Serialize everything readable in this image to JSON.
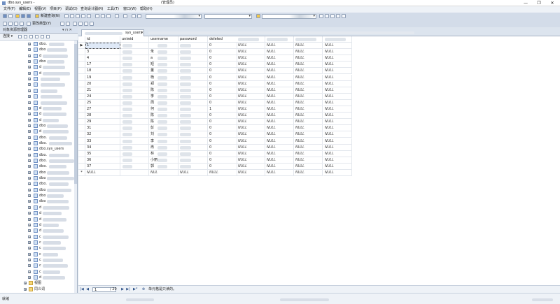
{
  "window": {
    "title": "dbo.sys_users -",
    "badge": "(管理员)",
    "minimize": "—",
    "maximize": "❐",
    "close": "✕"
  },
  "menu": [
    "文件(F)",
    "编辑(E)",
    "视图(V)",
    "项目(P)",
    "调试(D)",
    "查询设计器(R)",
    "工具(T)",
    "窗口(W)",
    "帮助(H)"
  ],
  "toolbar": {
    "new_query": "新建查询(N)",
    "change_type": "更改类型(Y)"
  },
  "object_explorer": {
    "title": "对象资源管理器",
    "pin": "▾ ⊓ ✕",
    "connect": "连接 ▾",
    "tree": [
      {
        "label": "dbo."
      },
      {
        "label": "dbo"
      },
      {
        "label": "d"
      },
      {
        "label": "dbo"
      },
      {
        "label": "d"
      },
      {
        "label": "d"
      },
      {
        "label": ""
      },
      {
        "label": ""
      },
      {
        "label": ""
      },
      {
        "label": ""
      },
      {
        "label": ""
      },
      {
        "label": "d"
      },
      {
        "label": "d"
      },
      {
        "label": "d"
      },
      {
        "label": "dbo"
      },
      {
        "label": "d"
      },
      {
        "label": "dbo."
      },
      {
        "label": "dbo."
      },
      {
        "label": "dbo.sys_users"
      },
      {
        "label": "dbo."
      },
      {
        "label": "dbo."
      },
      {
        "label": "dbo."
      },
      {
        "label": "dbo"
      },
      {
        "label": "dbo"
      },
      {
        "label": "dbo."
      },
      {
        "label": "dbo"
      },
      {
        "label": "dbo"
      },
      {
        "label": "dbo"
      },
      {
        "label": "d"
      },
      {
        "label": "d"
      },
      {
        "label": "d"
      },
      {
        "label": "d"
      },
      {
        "label": "d"
      },
      {
        "label": "c"
      },
      {
        "label": "c"
      },
      {
        "label": "c"
      },
      {
        "label": "c"
      },
      {
        "label": "c"
      },
      {
        "label": "c"
      },
      {
        "label": "c"
      },
      {
        "label": "d"
      }
    ],
    "folders": [
      {
        "label": "视图"
      },
      {
        "label": "同义词"
      }
    ]
  },
  "document": {
    "tab_label": "sys_users",
    "tab_close": "✕"
  },
  "grid": {
    "columns": [
      "id",
      "uniwid",
      "username",
      "password",
      "deleted"
    ],
    "null_text": "NULL",
    "rows": [
      {
        "id": "1",
        "uniwid": "",
        "username": "",
        "password": "",
        "deleted": "0",
        "name_char": "",
        "selected": true
      },
      {
        "id": "3",
        "uniwid": "",
        "username": "朱",
        "password": "",
        "deleted": "0",
        "name_char": ""
      },
      {
        "id": "4",
        "uniwid": "",
        "username": "a",
        "password": "",
        "deleted": "0",
        "name_char": ""
      },
      {
        "id": "17",
        "uniwid": "",
        "username": "短",
        "password": "",
        "deleted": "0",
        "name_char": ""
      },
      {
        "id": "18",
        "uniwid": "",
        "username": "董",
        "password": "",
        "deleted": "0",
        "name_char": ""
      },
      {
        "id": "19",
        "uniwid": "",
        "username": "杨",
        "password": "",
        "deleted": "0",
        "name_char": ""
      },
      {
        "id": "20",
        "uniwid": "",
        "username": "郑",
        "password": "",
        "deleted": "0",
        "name_char": ""
      },
      {
        "id": "21",
        "uniwid": "",
        "username": "陈",
        "password": "",
        "deleted": "0",
        "name_char": ""
      },
      {
        "id": "24",
        "uniwid": "",
        "username": "李",
        "password": "",
        "deleted": "0",
        "name_char": ""
      },
      {
        "id": "25",
        "uniwid": "",
        "username": "周",
        "password": "",
        "deleted": "0",
        "name_char": ""
      },
      {
        "id": "27",
        "uniwid": "",
        "username": "何",
        "password": "",
        "deleted": "1",
        "name_char": ""
      },
      {
        "id": "28",
        "uniwid": "",
        "username": "陈",
        "password": "",
        "deleted": "0",
        "name_char": ""
      },
      {
        "id": "29",
        "uniwid": "",
        "username": "陈",
        "password": "",
        "deleted": "0",
        "name_char": ""
      },
      {
        "id": "31",
        "uniwid": "",
        "username": "彭",
        "password": "",
        "deleted": "0",
        "name_char": ""
      },
      {
        "id": "32",
        "uniwid": "",
        "username": "刘",
        "password": "",
        "deleted": "0",
        "name_char": ""
      },
      {
        "id": "33",
        "uniwid": "",
        "username": "李",
        "password": "",
        "deleted": "0",
        "name_char": ""
      },
      {
        "id": "34",
        "uniwid": "",
        "username": "冉",
        "password": "",
        "deleted": "0",
        "name_char": ""
      },
      {
        "id": "35",
        "uniwid": "",
        "username": "林",
        "password": "",
        "deleted": "0",
        "name_char": ""
      },
      {
        "id": "36",
        "uniwid": "",
        "username": "小丽",
        "password": "",
        "deleted": "0",
        "name_char": ""
      },
      {
        "id": "37",
        "uniwid": "",
        "username": "郭",
        "password": "",
        "deleted": "0",
        "name_char": ""
      }
    ],
    "new_row": {
      "id": "NULL",
      "uniwid": "",
      "username": "NUL",
      "password": "NULL",
      "deleted": "NULL"
    }
  },
  "navigator": {
    "first": "|◀",
    "prev": "◀",
    "page": "1",
    "total": "/ 20",
    "next": "▶",
    "last": "▶|",
    "new": "▶*",
    "stop": "⊗",
    "message": "单元格是只读的。"
  },
  "status": {
    "text": "就绪"
  }
}
